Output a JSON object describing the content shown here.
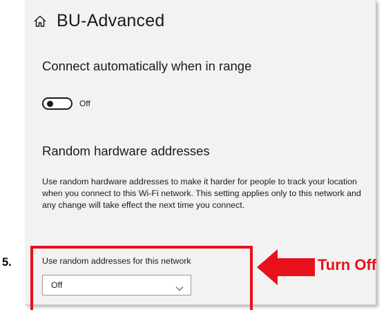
{
  "header": {
    "title": "BU-Advanced",
    "home_icon": "home-icon"
  },
  "connect": {
    "heading": "Connect automatically when in range",
    "toggle_state": "Off"
  },
  "random_hw": {
    "heading": "Random hardware addresses",
    "description": "Use random hardware addresses to make it harder for people to track your location when you connect to this Wi-Fi network. This setting applies only to this network and any change will take effect the next time you connect.",
    "select_label": "Use random addresses for this network",
    "select_value": "Off",
    "chevron_icon": "chevron-down-icon"
  },
  "annotation": {
    "step": "5.",
    "callout": "Turn Off",
    "color": "#e8101a",
    "arrow_icon": "left-arrow-icon"
  }
}
